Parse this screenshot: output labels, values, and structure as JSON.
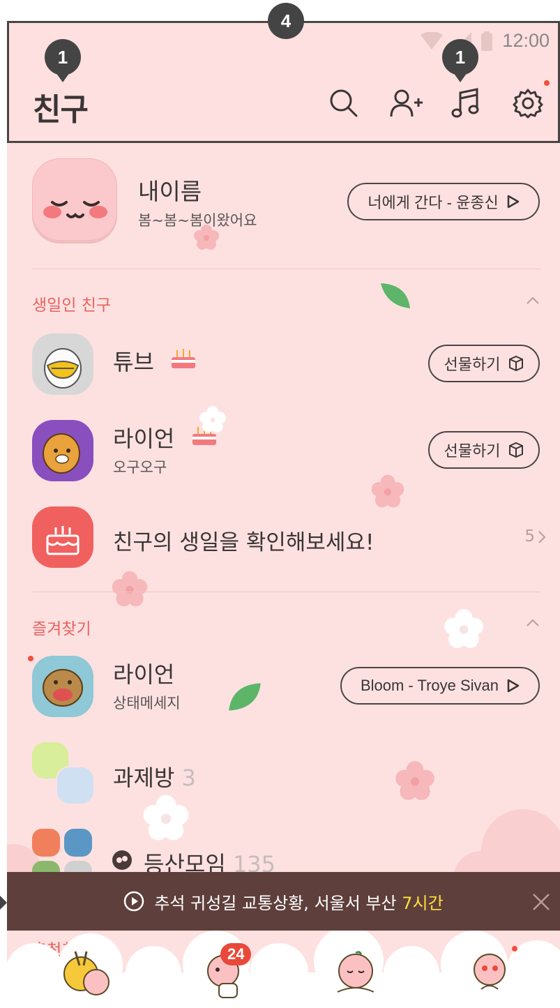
{
  "status_bar": {
    "time": "12:00"
  },
  "header": {
    "title": "친구"
  },
  "annotations": {
    "marker_title": "1",
    "marker_music": "1",
    "marker_header": "4"
  },
  "my_profile": {
    "name": "내이름",
    "status_message": "봄~봄~봄이왔어요",
    "music_label": "너에게 간다 - 윤종신"
  },
  "birthday_section": {
    "label": "생일인 친구",
    "friends": [
      {
        "name": "튜브",
        "gift_label": "선물하기"
      },
      {
        "name": "라이언",
        "status": "오구오구",
        "gift_label": "선물하기"
      }
    ],
    "check_label": "친구의 생일을 확인해보세요!",
    "check_count": "5"
  },
  "favorites_section": {
    "label": "즐겨찾기",
    "items": [
      {
        "name": "라이언",
        "status": "상태메세지",
        "music_label": "Bloom - Troye Sivan"
      },
      {
        "name": "과제방",
        "count": "3"
      },
      {
        "name": "등산모임",
        "count": "135"
      }
    ]
  },
  "recommend_label": "추천친구",
  "banner": {
    "text": "추석 귀성길 교통상황, 서울서 부산 ",
    "highlight": "7시간"
  },
  "bottom_nav": {
    "chats_badge": "24"
  },
  "colors": {
    "background": "#fde1e0",
    "accent_red": "#e8625e",
    "banner": "#5e3f3c",
    "highlight": "#ffe03a"
  }
}
